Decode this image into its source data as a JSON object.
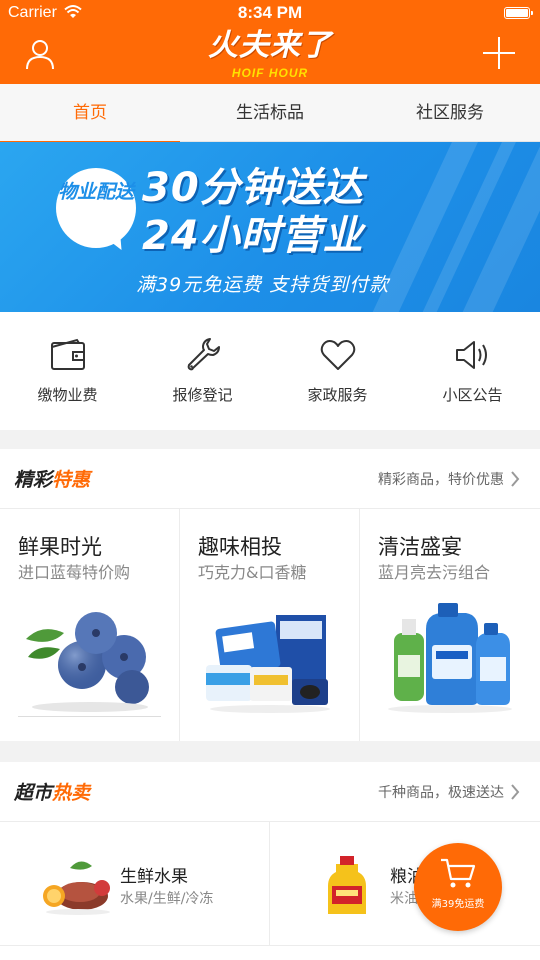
{
  "status_bar": {
    "carrier": "Carrier",
    "time": "8:34 PM"
  },
  "nav": {
    "logo_cn": "火夫来了",
    "logo_en": "HOIF HOUR",
    "user_icon": "user-icon",
    "add_icon": "plus-icon"
  },
  "tabs": [
    {
      "label": "首页",
      "active": true
    },
    {
      "label": "生活标品",
      "active": false
    },
    {
      "label": "社区服务",
      "active": false
    }
  ],
  "banner": {
    "bubble": "物业配送",
    "headline_1": "30分钟送达",
    "headline_2": "24小时营业",
    "subline": "满39元免运费  支持货到付款"
  },
  "services": [
    {
      "label": "缴物业费",
      "icon": "wallet-icon"
    },
    {
      "label": "报修登记",
      "icon": "wrench-icon"
    },
    {
      "label": "家政服务",
      "icon": "heart-icon"
    },
    {
      "label": "小区公告",
      "icon": "speaker-icon"
    }
  ],
  "section_featured": {
    "title_a": "精彩",
    "title_b": "特惠",
    "more": "精彩商品，特价优惠"
  },
  "promos": [
    {
      "title": "鲜果时光",
      "subtitle": "进口蓝莓特价购",
      "image": "blueberries-image"
    },
    {
      "title": "趣味相投",
      "subtitle": "巧克力&口香糖",
      "image": "snacks-image"
    },
    {
      "title": "清洁盛宴",
      "subtitle": "蓝月亮去污组合",
      "image": "detergent-image"
    }
  ],
  "section_hot": {
    "title_a": "超市",
    "title_b": "热卖",
    "more": "千种商品，极速送达"
  },
  "hot_items": [
    {
      "name": "生鲜水果",
      "subtitle": "水果/生鲜/冷冻",
      "image": "fresh-food-image"
    },
    {
      "name": "粮油调味",
      "subtitle": "米油/调味",
      "image": "cooking-oil-image"
    }
  ],
  "fab": {
    "label": "满39免运费",
    "icon": "cart-icon"
  },
  "colors": {
    "brand": "#ff6a06",
    "banner": "#1d8fe8"
  }
}
